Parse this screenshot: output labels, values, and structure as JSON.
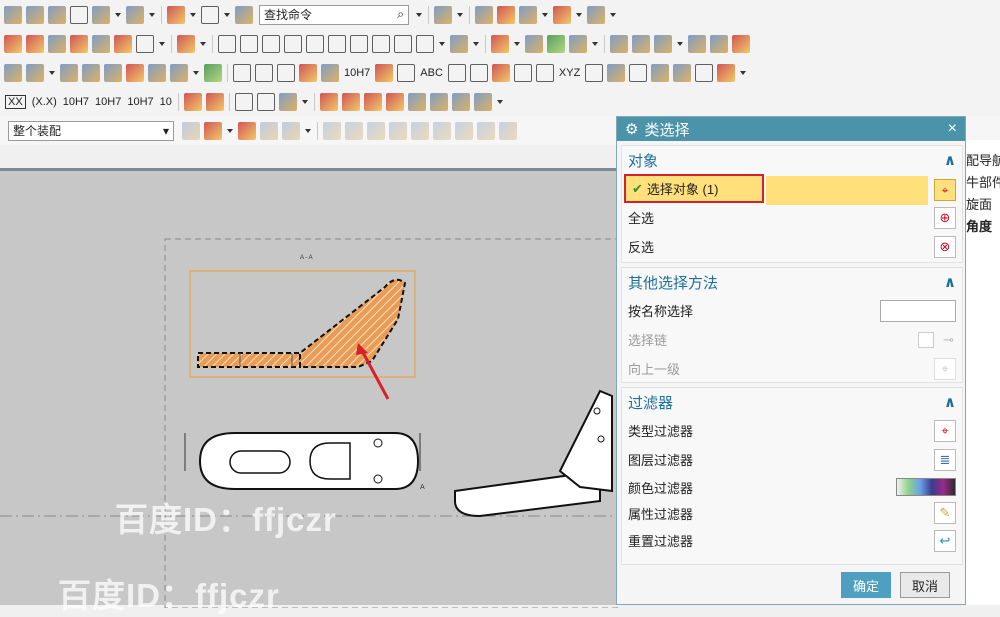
{
  "toolbar": {
    "search_value": "查找命令",
    "assembly_select": "整个装配",
    "tol_labels": [
      "XX",
      "(X.X)",
      "10H7",
      "10H7",
      "10H7",
      "10"
    ]
  },
  "watermark": "百度ID：ffjczr",
  "drawing": {
    "view_label": "A - A",
    "label_a": "A"
  },
  "dialog": {
    "title": "类选择",
    "close": "×",
    "sections": {
      "object": {
        "title": "对象",
        "items": [
          {
            "label": "选择对象 (1)",
            "selected": true
          },
          {
            "label": "全选"
          },
          {
            "label": "反选"
          }
        ]
      },
      "other": {
        "title": "其他选择方法",
        "items": [
          {
            "label": "按名称选择"
          },
          {
            "label": "选择链"
          },
          {
            "label": "向上一级"
          }
        ]
      },
      "filter": {
        "title": "过滤器",
        "items": [
          {
            "label": "类型过滤器"
          },
          {
            "label": "图层过滤器"
          },
          {
            "label": "颜色过滤器"
          },
          {
            "label": "属性过滤器"
          },
          {
            "label": "重置过滤器"
          }
        ]
      }
    },
    "ok": "确定",
    "cancel": "取消"
  },
  "side_panel": {
    "lines": [
      "配导航",
      "牛部件",
      "旋面",
      "角度"
    ]
  },
  "colors": {
    "accent": "#4a93a8",
    "selected_row": "#ffe07a",
    "highlight_box": "#d8202a",
    "hatch": "#e89c55"
  }
}
